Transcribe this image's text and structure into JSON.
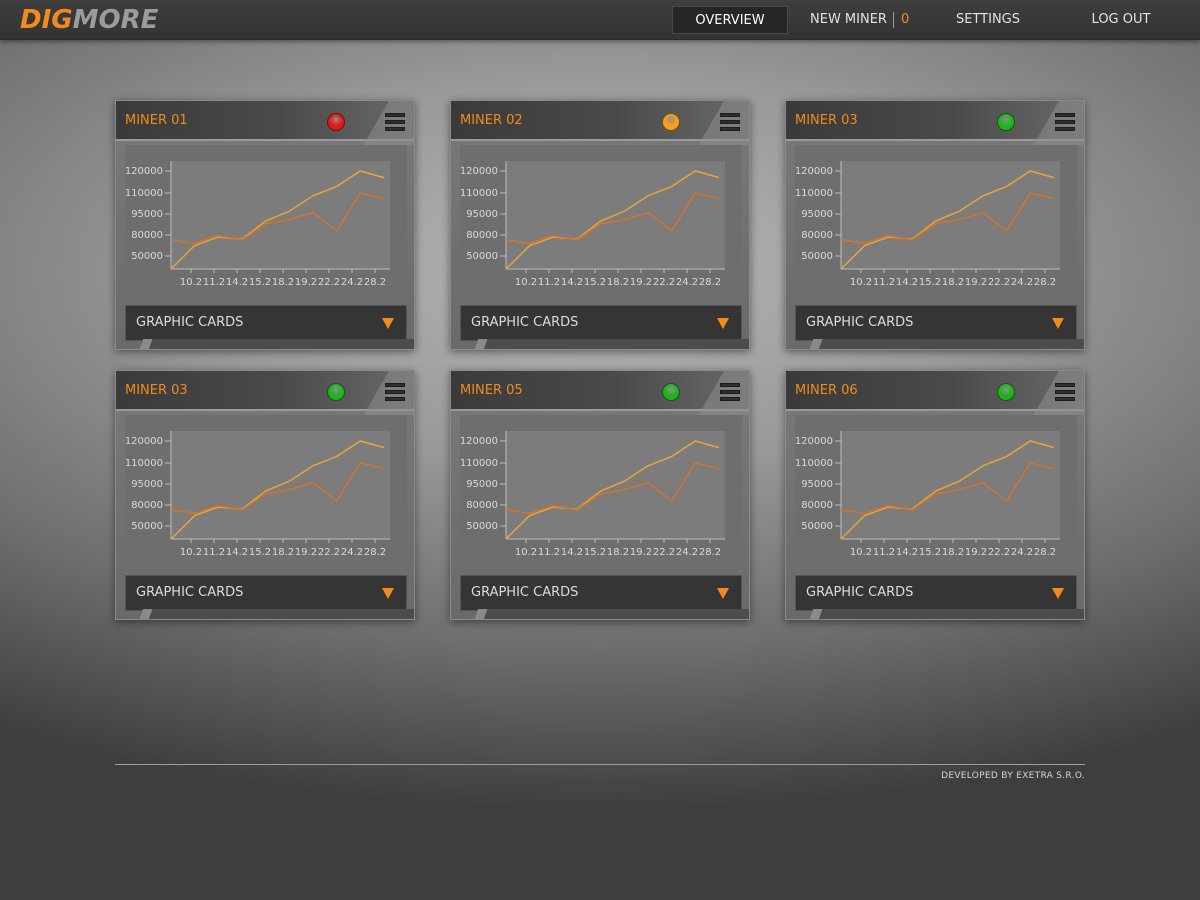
{
  "app": {
    "logo_part1": "DIG",
    "logo_part2": "MORE"
  },
  "nav": {
    "overview": "OVERVIEW",
    "new_miner": "NEW MINER",
    "new_miner_count": "0",
    "settings": "SETTINGS",
    "logout": "LOG OUT"
  },
  "colors": {
    "accent": "#f28a1e",
    "status_red": "#e11a1a",
    "status_orange": "#f5a11c",
    "status_green": "#1fb41f",
    "series_gold": "#e8a43a",
    "series_orange": "#d4742c"
  },
  "cards": [
    {
      "title": "MINER 01",
      "status": "red",
      "status_icon": "status-red-icon",
      "dropdown": "GRAPHIC CARDS"
    },
    {
      "title": "MINER 02",
      "status": "orange",
      "status_icon": "status-orange-icon",
      "dropdown": "GRAPHIC CARDS"
    },
    {
      "title": "MINER 03",
      "status": "green",
      "status_icon": "status-green-icon",
      "dropdown": "GRAPHIC CARDS"
    },
    {
      "title": "MINER 03",
      "status": "green",
      "status_icon": "status-green-icon",
      "dropdown": "GRAPHIC CARDS"
    },
    {
      "title": "MINER 05",
      "status": "green",
      "status_icon": "status-green-icon",
      "dropdown": "GRAPHIC CARDS"
    },
    {
      "title": "MINER 06",
      "status": "green",
      "status_icon": "status-green-icon",
      "dropdown": "GRAPHIC CARDS"
    }
  ],
  "chart_data": {
    "type": "line",
    "categories": [
      "10.2",
      "11.2",
      "14.2",
      "15.2",
      "18.2",
      "19.2",
      "22.2",
      "24.2",
      "28.2"
    ],
    "y_ticks": [
      50000,
      80000,
      95000,
      110000,
      120000
    ],
    "grid": false,
    "series": [
      {
        "color": "gold",
        "values": [
          40000,
          65000,
          77000,
          74000,
          90000,
          97000,
          108000,
          113000,
          120000,
          117000
        ]
      },
      {
        "color": "orange",
        "values": [
          73000,
          68000,
          79000,
          73000,
          88000,
          91000,
          96000,
          83000,
          110000,
          106000
        ]
      }
    ]
  },
  "footer": {
    "text": "DEVELOPED BY EXETRA S.R.O."
  }
}
